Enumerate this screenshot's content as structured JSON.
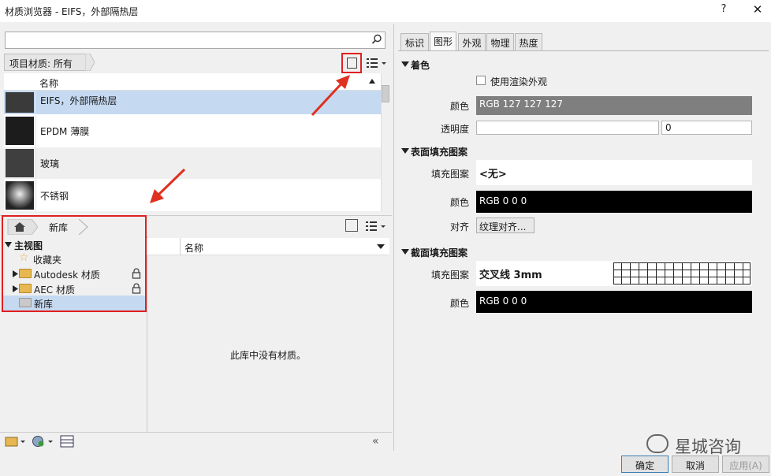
{
  "window": {
    "title": "材质浏览器 - EIFS，外部隔热层",
    "help": "?",
    "close": "✕"
  },
  "search": {
    "placeholder": "",
    "value": ""
  },
  "project": {
    "filter_label": "项目材质: 所有",
    "column_name": "名称",
    "materials": [
      {
        "name": "EIFS，外部隔热层",
        "selected": true
      },
      {
        "name": "EPDM 薄膜",
        "selected": false
      },
      {
        "name": "玻璃",
        "selected": false
      },
      {
        "name": "不锈钢",
        "selected": false
      }
    ]
  },
  "library": {
    "breadcrumb": "新库",
    "column_name": "名称",
    "empty_message": "此库中没有材质。",
    "tree": [
      {
        "label": "主视图",
        "bold": true
      },
      {
        "label": "收藏夹"
      },
      {
        "label": "Autodesk 材质",
        "locked": true
      },
      {
        "label": "AEC 材质",
        "locked": true
      },
      {
        "label": "新库",
        "selected": true
      }
    ]
  },
  "tabs": [
    "标识",
    "图形",
    "外观",
    "物理",
    "热度"
  ],
  "active_tab": "图形",
  "shading": {
    "header": "着色",
    "use_render_label": "使用渲染外观",
    "color_label": "颜色",
    "color_value": "RGB 127 127 127",
    "transparency_label": "透明度",
    "transparency_value": "0"
  },
  "surface": {
    "header": "表面填充图案",
    "pattern_label": "填充图案",
    "pattern_value": "<无>",
    "color_label": "颜色",
    "color_value": "RGB 0 0 0",
    "align_label": "对齐",
    "align_button": "纹理对齐..."
  },
  "cut": {
    "header": "截面填充图案",
    "pattern_label": "填充图案",
    "pattern_value": "交叉线 3mm",
    "color_label": "颜色",
    "color_value": "RGB 0 0 0"
  },
  "buttons": {
    "ok": "确定",
    "cancel": "取消",
    "apply": "应用(A)"
  },
  "watermark": "星城咨询",
  "colors": {
    "selected_row": "#c5d9f1",
    "shading_color": "#7f7f7f",
    "highlight": "#e02020"
  }
}
